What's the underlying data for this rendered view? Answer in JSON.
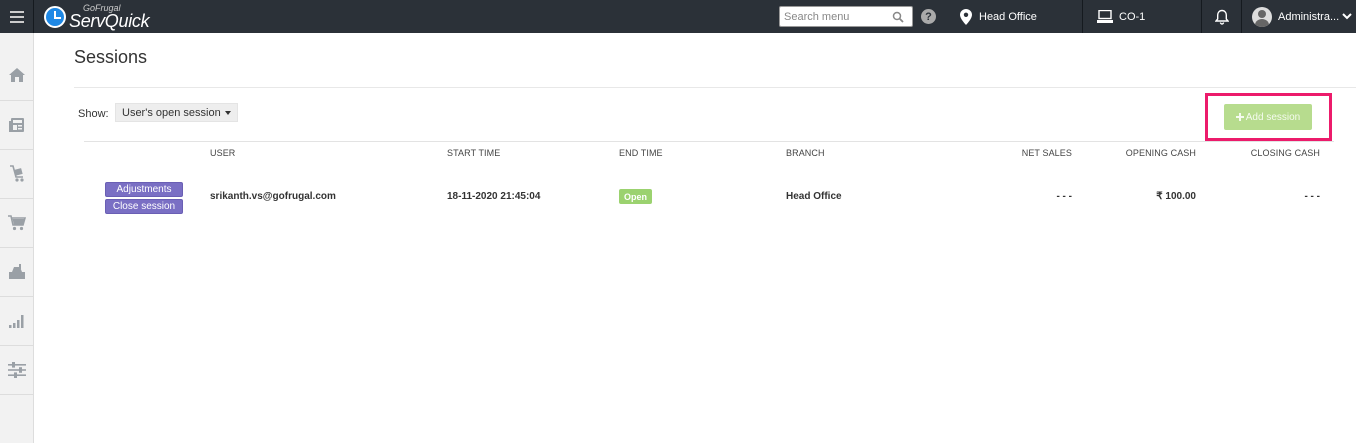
{
  "header": {
    "brand_small": "GoFrugal",
    "brand_name": "ServQuick",
    "search_placeholder": "Search menu",
    "help": "?",
    "branch": "Head Office",
    "counter": "CO-1",
    "user": "Administra..."
  },
  "sidebar": {
    "items": [
      "home-icon",
      "news-icon",
      "cart-tag-icon",
      "shopping-cart-icon",
      "cash-register-icon",
      "bar-chart-icon",
      "settings-sliders-icon"
    ]
  },
  "page": {
    "title": "Sessions",
    "show_label": "Show:",
    "show_value": "User's open session",
    "add_session_label": "Add session"
  },
  "table": {
    "columns": [
      "USER",
      "START TIME",
      "END TIME",
      "BRANCH",
      "NET SALES",
      "OPENING CASH",
      "CLOSING CASH"
    ],
    "rows": [
      {
        "actions": [
          "Adjustments",
          "Close session"
        ],
        "user": "srikanth.vs@gofrugal.com",
        "start_time": "18-11-2020 21:45:04",
        "end_time": "Open",
        "branch": "Head Office",
        "net_sales": "- - -",
        "opening_cash": "₹ 100.00",
        "closing_cash": "- - -"
      }
    ]
  },
  "colors": {
    "topbar": "#2b3138",
    "action_button": "#7a6fc4",
    "open_badge": "#9bd26f",
    "add_button": "#b7dc8e",
    "highlight": "#ec1b6b"
  }
}
